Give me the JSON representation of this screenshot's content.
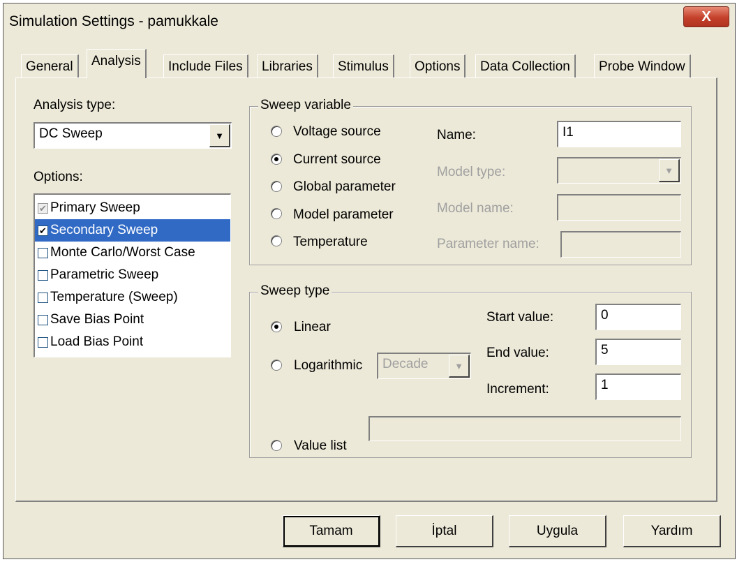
{
  "window": {
    "title": "Simulation Settings - pamukkale",
    "close_glyph": "X"
  },
  "tabs": [
    "General",
    "Analysis",
    "Include Files",
    "Libraries",
    "Stimulus",
    "Options",
    "Data Collection",
    "Probe Window"
  ],
  "active_tab": "Analysis",
  "analysis_type": {
    "label": "Analysis type:",
    "value": "DC Sweep"
  },
  "options": {
    "label": "Options:",
    "items": [
      {
        "label": "Primary Sweep",
        "checked": true,
        "greyed": true
      },
      {
        "label": "Secondary Sweep",
        "checked": true,
        "selected": true
      },
      {
        "label": "Monte Carlo/Worst Case",
        "checked": false
      },
      {
        "label": "Parametric Sweep",
        "checked": false
      },
      {
        "label": "Temperature (Sweep)",
        "checked": false
      },
      {
        "label": "Save Bias Point",
        "checked": false
      },
      {
        "label": "Load Bias Point",
        "checked": false
      }
    ]
  },
  "sweep_variable": {
    "title": "Sweep variable",
    "radios": [
      "Voltage source",
      "Current source",
      "Global parameter",
      "Model parameter",
      "Temperature"
    ],
    "selected": "Current source",
    "name_label": "Name:",
    "name_value": "I1",
    "model_type_label": "Model type:",
    "model_name_label": "Model name:",
    "parameter_name_label": "Parameter name:"
  },
  "sweep_type": {
    "title": "Sweep type",
    "linear_label": "Linear",
    "logarithmic_label": "Logarithmic",
    "log_scale": "Decade",
    "value_list_label": "Value list",
    "selected": "Linear",
    "start_label": "Start value:",
    "start_value": "0",
    "end_label": "End value:",
    "end_value": "5",
    "increment_label": "Increment:",
    "increment_value": "1"
  },
  "buttons": {
    "ok": "Tamam",
    "cancel": "İptal",
    "apply": "Uygula",
    "help": "Yardım"
  }
}
